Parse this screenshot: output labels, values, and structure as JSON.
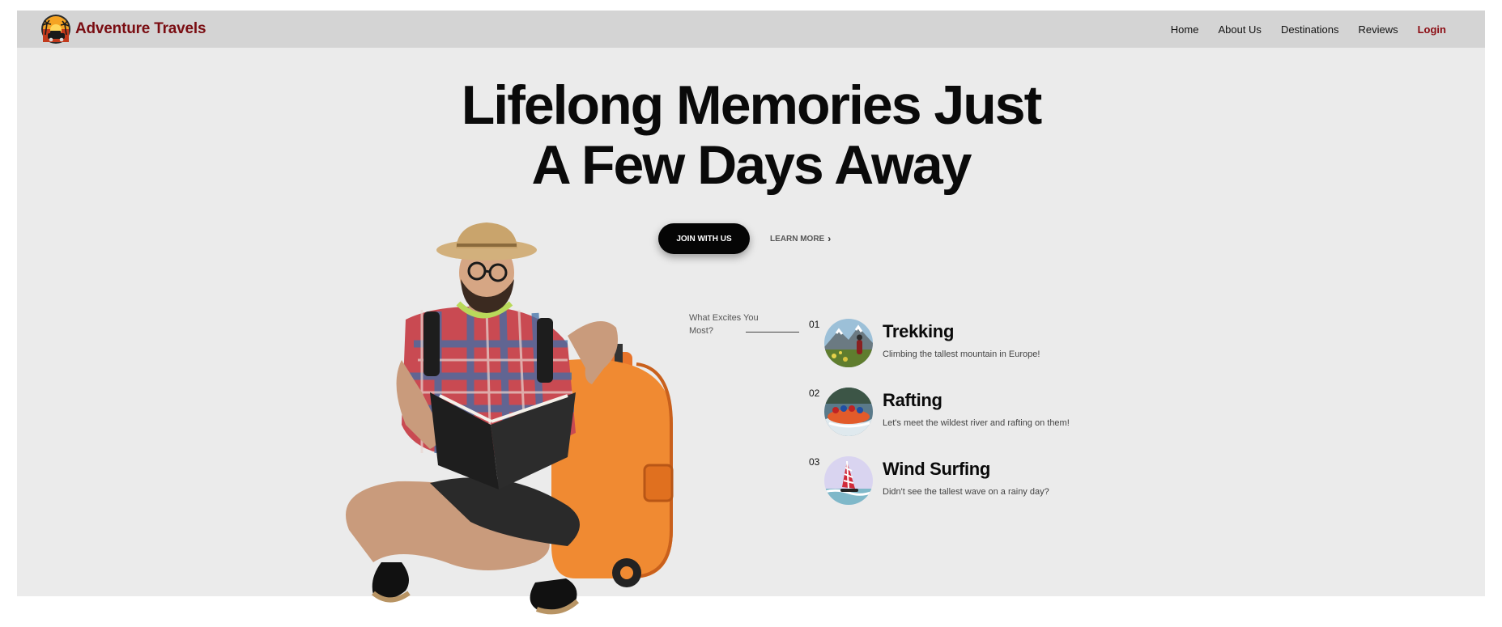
{
  "brand": {
    "name": "Adventure Travels",
    "logo_icon": "sunset-palm-car-icon",
    "accent": "#7a0d12"
  },
  "nav": {
    "items": [
      "Home",
      "About Us",
      "Destinations",
      "Reviews"
    ],
    "login": "Login"
  },
  "hero": {
    "headline_line1": "Lifelong Memories Just",
    "headline_line2": "A Few Days Away",
    "join_button": "JOIN WITH US",
    "learn_more": "LEARN MORE",
    "learn_more_icon": "chevron-right-icon",
    "image": "traveler-reading-book-with-suitcase"
  },
  "activities": {
    "intro": "What Excites You Most?",
    "items": [
      {
        "num": "01",
        "title": "Trekking",
        "desc": "Climbing the tallest mountain in Europe!",
        "thumb": "mountain-hiker-thumbnail"
      },
      {
        "num": "02",
        "title": "Rafting",
        "desc": "Let's meet the wildest river and rafting on them!",
        "thumb": "river-raft-thumbnail"
      },
      {
        "num": "03",
        "title": "Wind Surfing",
        "desc": "Didn't see the tallest wave on a rainy day?",
        "thumb": "windsurfer-thumbnail"
      }
    ]
  },
  "colors": {
    "navbar": "#d4d4d4",
    "page": "#ebebeb",
    "button": "#050505",
    "login": "#8b0b12"
  }
}
